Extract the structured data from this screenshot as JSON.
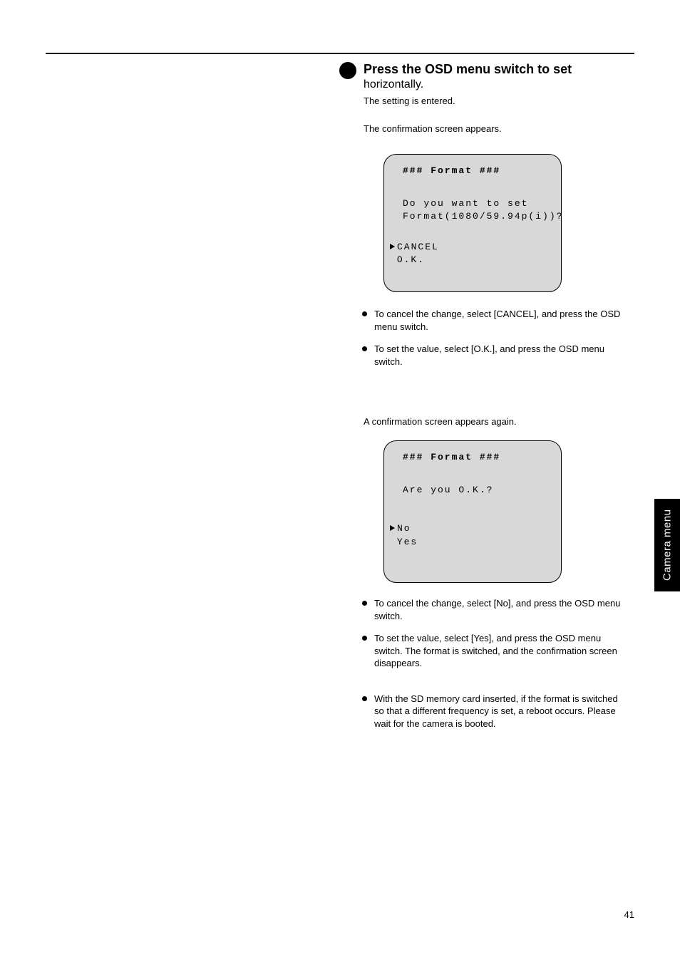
{
  "pageNumber": "41",
  "sideTab": "Camera menu",
  "step3": {
    "line1": "Press the OSD menu switch to set",
    "line2": "horizontally.",
    "line3": "The setting is entered."
  },
  "confirmText": "The confirmation screen appears.",
  "lcd1": {
    "title": "### Format ###",
    "body1": "Do you want to set",
    "body2": "Format(1080/59.94p(i))?",
    "opt1": "CANCEL",
    "opt2": "O.K."
  },
  "bullets1": {
    "item1": "To cancel the change, select [CANCEL], and press the OSD menu switch.",
    "item2": "To set the value, select [O.K.], and press the OSD menu switch."
  },
  "confirmAgain": "A confirmation screen appears again.",
  "lcd2": {
    "title": "### Format ###",
    "body1": "Are you O.K.?",
    "opt1": "No",
    "opt2": "Yes"
  },
  "bullets2": {
    "item1": "To cancel the change, select [No], and press the OSD menu switch.",
    "item2": "To set the value, select [Yes], and press the OSD menu switch.\nThe format is switched, and the confirmation screen disappears.",
    "item3": "With the SD memory card inserted, if the format is switched so that a different frequency is set, a reboot occurs.\nPlease wait for the camera is booted."
  }
}
